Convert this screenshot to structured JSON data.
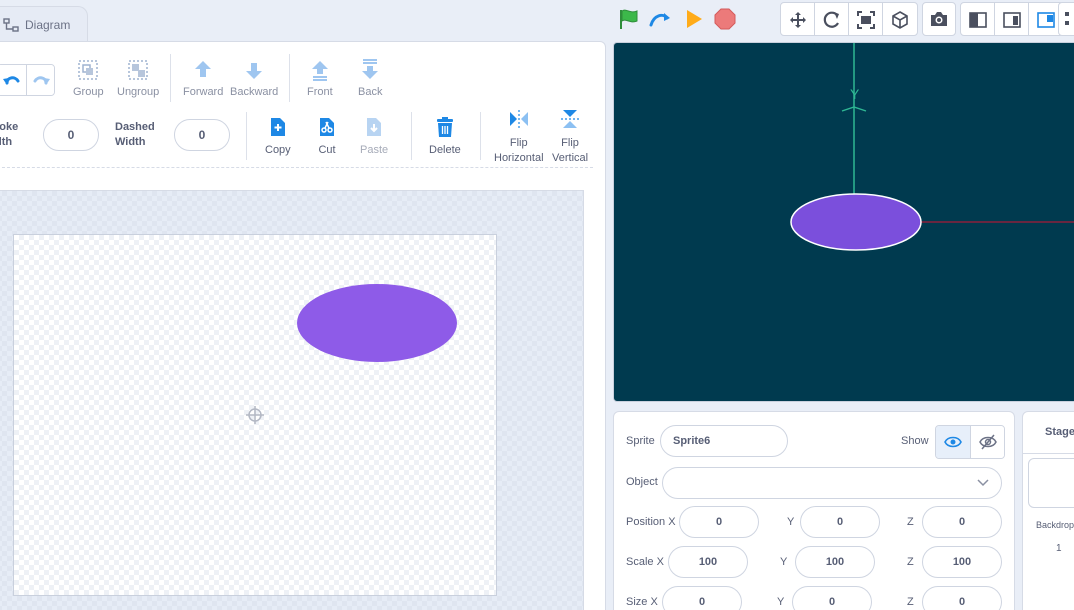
{
  "tabs": {
    "diagram": "Diagram"
  },
  "editor": {
    "tools_row1": [
      {
        "label": "Group"
      },
      {
        "label": "Ungroup"
      },
      {
        "label": "Forward"
      },
      {
        "label": "Backward"
      },
      {
        "label": "Front"
      },
      {
        "label": "Back"
      }
    ],
    "stroke_width": {
      "label_line1": "roke",
      "label_line2": "dth",
      "value": "0"
    },
    "dashed_width": {
      "label_line1": "Dashed",
      "label_line2": "Width",
      "value": "0"
    },
    "tools_row2": {
      "copy": "Copy",
      "cut": "Cut",
      "paste": "Paste",
      "delete": "Delete",
      "flip_h_line1": "Flip",
      "flip_h_line2": "Horizontal",
      "flip_v_line1": "Flip",
      "flip_v_line2": "Vertical"
    },
    "shape_color": "#8e5be8"
  },
  "stage": {
    "axis_y_label": "Y",
    "background": "#003a4f",
    "axis_y_color": "#2fb894",
    "axis_x_color": "#8a1f3b",
    "ellipse_color": "#7b4fdc"
  },
  "sprite": {
    "sprite_label": "Sprite",
    "sprite_name": "Sprite6",
    "show_label": "Show",
    "object_label": "Object",
    "object_value": "",
    "position": {
      "label": "Position X",
      "x": "0",
      "y_label": "Y",
      "y": "0",
      "z_label": "Z",
      "z": "0"
    },
    "scale": {
      "label": "Scale X",
      "x": "100",
      "y_label": "Y",
      "y": "100",
      "z_label": "Z",
      "z": "100"
    },
    "size": {
      "label": "Size X",
      "x": "0",
      "y_label": "Y",
      "y": "0",
      "z_label": "Z",
      "z": "0"
    }
  },
  "stage_panel": {
    "title": "Stage",
    "backdrops_label": "Backdrop",
    "backdrops_count": "1"
  },
  "icons": {
    "green_flag": "green-flag-icon",
    "step": "step-icon",
    "play": "play-icon",
    "stop": "stop-icon",
    "move": "move-icon",
    "rotate": "rotate-icon",
    "fit": "fit-icon",
    "cube": "cube-icon",
    "camera": "camera-icon",
    "layout_left": "layout-left-icon",
    "layout_right": "layout-right-icon",
    "layout_small": "layout-small-icon"
  }
}
